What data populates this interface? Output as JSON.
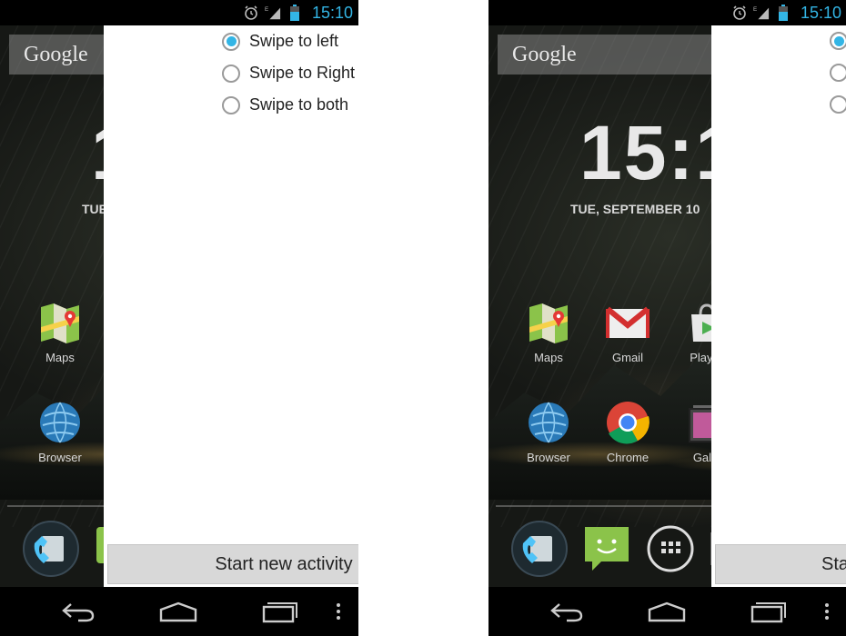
{
  "status_bar": {
    "time": "15:10",
    "network": "E",
    "time_color": "#33b5e5"
  },
  "home": {
    "search_label": "Google",
    "clock_left": "1",
    "clock_right": "15:1",
    "date_left": "TUE",
    "date_right": "TUE, SEPTEMBER 10",
    "apps_left": [
      "Maps",
      "Browser"
    ],
    "apps_right": [
      "Maps",
      "Gmail",
      "Play S",
      "Browser",
      "Chrome",
      "Galle"
    ]
  },
  "activity": {
    "options": [
      {
        "label": "Swipe to left",
        "checked": true
      },
      {
        "label": "Swipe to Right",
        "checked": false
      },
      {
        "label": "Swipe to both",
        "checked": false
      }
    ],
    "button_label": "Start new activity",
    "button_label_cut": "Sta"
  },
  "colors": {
    "accent": "#33b5e5",
    "overlay_bg": "#ffffff",
    "button_bg": "#d8d8d8"
  },
  "icons": [
    "alarm-icon",
    "signal-icon",
    "battery-icon",
    "back-icon",
    "home-icon",
    "recents-icon",
    "menu-icon",
    "phone-icon",
    "messaging-icon",
    "app-drawer-icon"
  ]
}
